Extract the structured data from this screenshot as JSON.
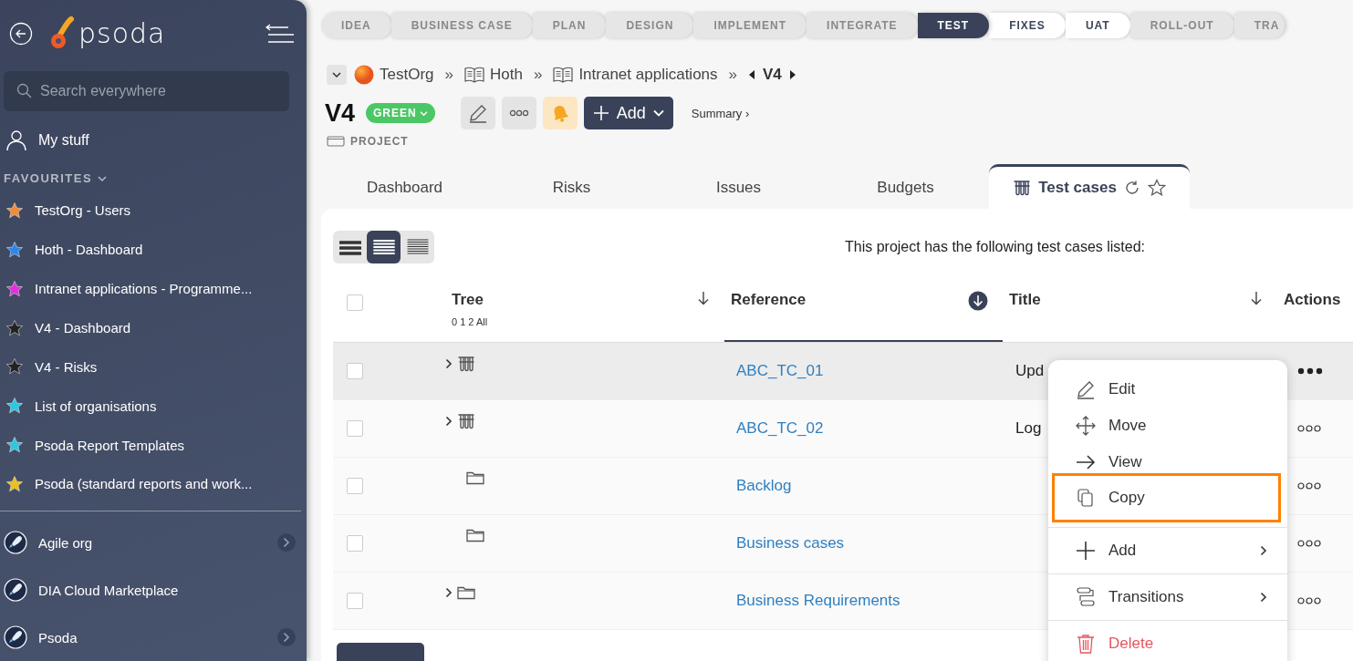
{
  "sidebar": {
    "logo": "psoda",
    "search": {
      "placeholder": "Search everywhere"
    },
    "my_stuff": "My stuff",
    "favourites_heading": "FAVOURITES",
    "favourites": [
      {
        "label": "TestOrg - Users",
        "color": "#f28c38"
      },
      {
        "label": "Hoth - Dashboard",
        "color": "#2f86e8"
      },
      {
        "label": "Intranet applications - Programme...",
        "color": "#e030e0"
      },
      {
        "label": "V4 - Dashboard",
        "color": "#222222"
      },
      {
        "label": "V4 - Risks",
        "color": "#222222"
      },
      {
        "label": "List of organisations",
        "color": "#2ec8e0"
      },
      {
        "label": "Psoda Report Templates",
        "color": "#2ec8e0"
      },
      {
        "label": "Psoda (standard reports and work...",
        "color": "#e8c020"
      }
    ],
    "organisations": [
      {
        "label": "Agile org",
        "has_submenu": true
      },
      {
        "label": "DIA Cloud Marketplace",
        "has_submenu": false
      },
      {
        "label": "Psoda",
        "has_submenu": true
      }
    ]
  },
  "stages": [
    {
      "label": "IDEA",
      "selected": false,
      "highlighted": false
    },
    {
      "label": "BUSINESS CASE",
      "selected": false,
      "highlighted": false
    },
    {
      "label": "PLAN",
      "selected": false,
      "highlighted": false
    },
    {
      "label": "DESIGN",
      "selected": false,
      "highlighted": false
    },
    {
      "label": "IMPLEMENT",
      "selected": false,
      "highlighted": false
    },
    {
      "label": "INTEGRATE",
      "selected": false,
      "highlighted": false
    },
    {
      "label": "TEST",
      "selected": true,
      "highlighted": false
    },
    {
      "label": "FIXES",
      "selected": false,
      "highlighted": true
    },
    {
      "label": "UAT",
      "selected": false,
      "highlighted": true
    },
    {
      "label": "ROLL-OUT",
      "selected": false,
      "highlighted": false
    },
    {
      "label": "TRA",
      "selected": false,
      "highlighted": false
    }
  ],
  "breadcrumb": {
    "items": [
      {
        "label": "TestOrg",
        "kind": "org"
      },
      {
        "label": "Hoth",
        "kind": "book"
      },
      {
        "label": "Intranet applications",
        "kind": "book"
      }
    ],
    "separator": "»",
    "current": "V4"
  },
  "project": {
    "title": "V4",
    "status": "GREEN",
    "type": "PROJECT",
    "add_button": "Add",
    "summary_link": "Summary ›"
  },
  "tabs": [
    {
      "label": "Dashboard",
      "selected": false
    },
    {
      "label": "Risks",
      "selected": false
    },
    {
      "label": "Issues",
      "selected": false
    },
    {
      "label": "Budgets",
      "selected": false
    },
    {
      "label": "Test cases",
      "selected": true
    }
  ],
  "view_modes": [
    {
      "kind": "large",
      "selected": false
    },
    {
      "kind": "medium",
      "selected": true
    },
    {
      "kind": "compact",
      "selected": false
    }
  ],
  "intro": "This project has the following test cases listed:",
  "table": {
    "select_all": {
      "checked": false
    },
    "columns": [
      {
        "label": "Tree",
        "sub": "0 1 2 All",
        "sortable": true,
        "sorted": false
      },
      {
        "label": "Reference",
        "sortable": true,
        "sorted": true
      },
      {
        "label": "Title",
        "sortable": true,
        "sorted": false
      },
      {
        "label": "Actions",
        "sortable": false
      }
    ],
    "rows": [
      {
        "kind": "test-case",
        "expandable": true,
        "reference": "ABC_TC_01",
        "title": "Upd",
        "checked": false,
        "highlighted": true,
        "menu_open": true
      },
      {
        "kind": "test-case",
        "expandable": true,
        "reference": "ABC_TC_02",
        "title": "Log",
        "checked": false,
        "highlighted": false,
        "menu_open": false
      },
      {
        "kind": "folder",
        "expandable": false,
        "reference": "Backlog",
        "checked": false,
        "highlighted": false,
        "menu_open": false
      },
      {
        "kind": "folder",
        "expandable": false,
        "reference": "Business cases",
        "checked": false,
        "highlighted": false,
        "menu_open": false
      },
      {
        "kind": "folder",
        "expandable": true,
        "reference": "Business Requirements",
        "checked": false,
        "highlighted": false,
        "menu_open": false
      }
    ]
  },
  "context_menu": [
    {
      "kind": "edit",
      "label": "Edit",
      "highlighted": false,
      "danger": false,
      "submenu": false,
      "divider_after": false
    },
    {
      "kind": "move",
      "label": "Move",
      "highlighted": false,
      "danger": false,
      "submenu": false,
      "divider_after": false
    },
    {
      "kind": "view",
      "label": "View",
      "highlighted": false,
      "danger": false,
      "submenu": false,
      "divider_after": false
    },
    {
      "kind": "copy",
      "label": "Copy",
      "highlighted": true,
      "danger": false,
      "submenu": false,
      "divider_after": true
    },
    {
      "kind": "add",
      "label": "Add",
      "highlighted": false,
      "danger": false,
      "submenu": true,
      "divider_after": true
    },
    {
      "kind": "transitions",
      "label": "Transitions",
      "highlighted": false,
      "danger": false,
      "submenu": true,
      "divider_after": true
    },
    {
      "kind": "delete",
      "label": "Delete",
      "highlighted": false,
      "danger": true,
      "submenu": false,
      "divider_after": false
    }
  ]
}
